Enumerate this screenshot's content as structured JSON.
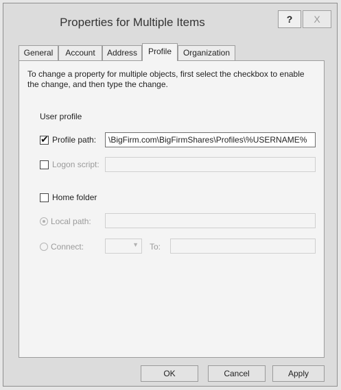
{
  "window": {
    "title": "Properties for Multiple Items",
    "help_label": "?",
    "close_label": "X"
  },
  "tabs": [
    {
      "label": "General"
    },
    {
      "label": "Account"
    },
    {
      "label": "Address"
    },
    {
      "label": "Profile",
      "active": true
    },
    {
      "label": "Organization"
    }
  ],
  "panel": {
    "instructions": "To change a property for multiple objects, first select the checkbox to enable the change, and then type the change.",
    "group_label": "User profile",
    "profile_path": {
      "label": "Profile path:",
      "checked": true,
      "value": "\\BigFirm.com\\BigFirmShares\\Profiles\\%USERNAME%"
    },
    "logon_script": {
      "label": "Logon script:",
      "checked": false,
      "value": ""
    },
    "home_folder": {
      "label": "Home folder",
      "checked": false
    },
    "local_path": {
      "label": "Local path:",
      "selected": true,
      "value": ""
    },
    "connect": {
      "label": "Connect:",
      "selected": false,
      "drive_value": "",
      "to_label": "To:",
      "to_value": ""
    }
  },
  "buttons": {
    "ok": "OK",
    "cancel": "Cancel",
    "apply": "Apply"
  },
  "check_mark": "✔",
  "dropdown_arrow": "▼"
}
